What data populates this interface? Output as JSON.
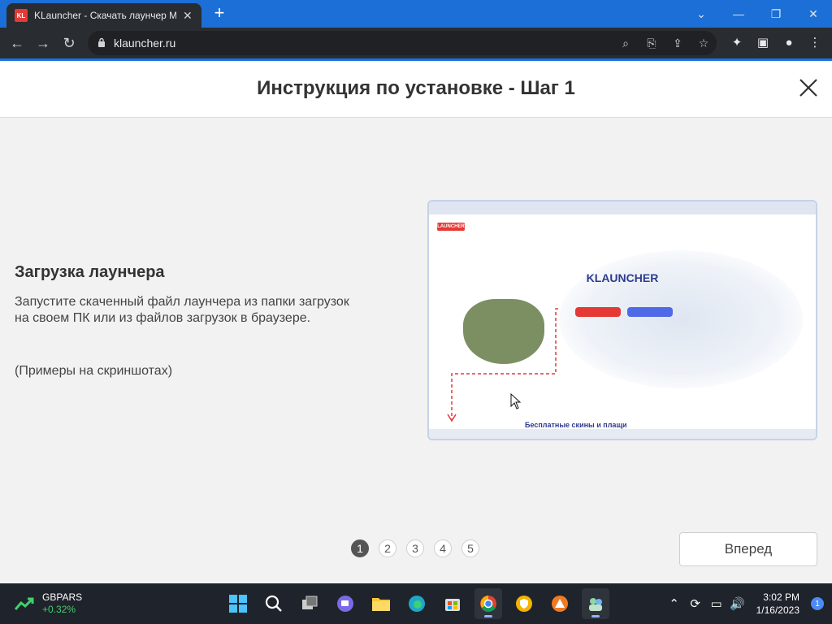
{
  "browser": {
    "tab_favicon_text": "KL",
    "tab_title": "KLauncher - Скачать лаунчер М",
    "url": "klauncher.ru"
  },
  "modal": {
    "title": "Инструкция по установке - Шаг 1",
    "heading": "Загрузка лаунчера",
    "description": "Запустите скаченный файл лаунчера из папки загрузок на своем ПК или из файлов загрузок в браузере.",
    "note": "(Примеры на скриншотах)",
    "screenshot": {
      "logo_text": "LAUNCHER",
      "title": "KLAUNCHER",
      "bottom_text": "Бесплатные скины и плащи"
    },
    "pages": [
      "1",
      "2",
      "3",
      "4",
      "5"
    ],
    "active_page": "1",
    "next_label": "Вперед"
  },
  "taskbar": {
    "widget_name": "GBPARS",
    "widget_change": "+0.32%",
    "time": "3:02 PM",
    "date": "1/16/2023",
    "notifications": "1"
  },
  "colors": {
    "accent_red": "#e53935",
    "accent_blue": "#4f6ae6",
    "title_text": "#333333"
  }
}
